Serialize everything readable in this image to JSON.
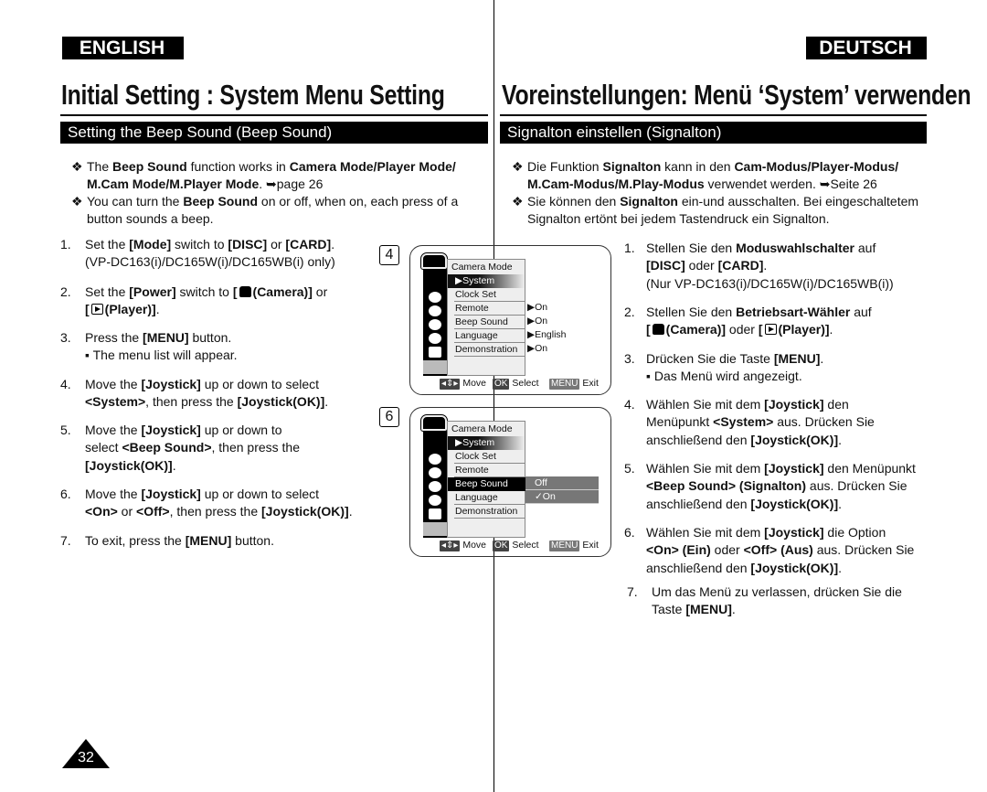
{
  "header": {
    "english": "ENGLISH",
    "deutsch": "DEUTSCH",
    "title_en": "Initial Setting : System Menu Setting",
    "title_de": "Voreinstellungen: Menü ‘System’ verwenden",
    "section_en": "Setting the Beep Sound (Beep Sound)",
    "section_de": "Signalton einstellen (Signalton)"
  },
  "en": {
    "bullets": [
      [
        [
          "The ",
          {
            "b": "Beep Sound"
          },
          " function works in ",
          {
            "b": "Camera Mode/Player Mode/"
          }
        ],
        [
          {
            "b": "M.Cam Mode/M.Player Mode"
          },
          ". ➥page 26"
        ]
      ],
      [
        [
          "You can turn the ",
          {
            "b": "Beep Sound"
          },
          " on or off, when on, each press of a"
        ],
        [
          "button sounds a beep."
        ]
      ]
    ],
    "steps": [
      {
        "n": "1.",
        "lines": [
          [
            "Set the ",
            {
              "b": "[Mode]"
            },
            " switch to ",
            {
              "b": "[DISC]"
            },
            " or ",
            {
              "b": "[CARD]"
            },
            "."
          ],
          [
            "(VP-DC163(i)/DC165W(i)/DC165WB(i) only)"
          ]
        ]
      },
      {
        "n": "2.",
        "lines": [
          [
            "Set the ",
            {
              "b": "[Power]"
            },
            " switch to ",
            {
              "b": "["
            },
            {
              "i": "cam"
            },
            {
              "b": "(Camera)]"
            },
            " or"
          ],
          [
            {
              "b": "["
            },
            {
              "i": "play"
            },
            {
              "b": "(Player)]"
            },
            "."
          ]
        ]
      },
      {
        "n": "3.",
        "lines": [
          [
            "Press the ",
            {
              "b": "[MENU]"
            },
            " button."
          ],
          [
            "▪  The menu list will appear."
          ]
        ]
      },
      {
        "n": "4.",
        "lines": [
          [
            "Move the ",
            {
              "b": "[Joystick]"
            },
            " up or down to select"
          ],
          [
            {
              "b": "<System>"
            },
            ", then press the ",
            {
              "b": "[Joystick(OK)]"
            },
            "."
          ]
        ]
      },
      {
        "n": "5.",
        "lines": [
          [
            "Move the ",
            {
              "b": "[Joystick]"
            },
            " up or down to"
          ],
          [
            "select ",
            {
              "b": "<Beep Sound>"
            },
            ", then press the"
          ],
          [
            {
              "b": "[Joystick(OK)]"
            },
            "."
          ]
        ]
      },
      {
        "n": "6.",
        "lines": [
          [
            "Move the ",
            {
              "b": "[Joystick]"
            },
            " up or down to select"
          ],
          [
            {
              "b": "<On>"
            },
            " or ",
            {
              "b": "<Off>"
            },
            ", then press the ",
            {
              "b": "[Joystick(OK)]"
            },
            "."
          ]
        ]
      },
      {
        "n": "7.",
        "lines": [
          [
            "To exit, press the ",
            {
              "b": "[MENU]"
            },
            " button."
          ]
        ]
      }
    ]
  },
  "de": {
    "bullets": [
      [
        [
          "Die Funktion ",
          {
            "b": "Signalton"
          },
          " kann in den ",
          {
            "b": "Cam-Modus/Player-Modus/"
          }
        ],
        [
          {
            "b": "M.Cam-Modus/M.Play-Modus"
          },
          " verwendet werden. ➥Seite 26"
        ]
      ],
      [
        [
          "Sie können den ",
          {
            "b": "Signalton"
          },
          " ein-und ausschalten. Bei eingeschaltetem"
        ],
        [
          "Signalton ertönt bei jedem Tastendruck ein Signalton."
        ]
      ]
    ],
    "steps": [
      {
        "n": "1.",
        "lines": [
          [
            "Stellen Sie den ",
            {
              "b": "Moduswahlschalter"
            },
            " auf"
          ],
          [
            {
              "b": "[DISC]"
            },
            " oder ",
            {
              "b": "[CARD]"
            },
            "."
          ],
          [
            "(Nur VP-DC163(i)/DC165W(i)/DC165WB(i))"
          ]
        ]
      },
      {
        "n": "2.",
        "lines": [
          [
            "Stellen Sie den ",
            {
              "b": "Betriebsart-Wähler"
            },
            " auf"
          ],
          [
            {
              "b": "["
            },
            {
              "i": "cam"
            },
            {
              "b": "(Camera)]"
            },
            " oder ",
            {
              "b": "["
            },
            {
              "i": "play"
            },
            {
              "b": "(Player)]"
            },
            "."
          ]
        ]
      },
      {
        "n": "3.",
        "lines": [
          [
            "Drücken Sie die Taste ",
            {
              "b": "[MENU]"
            },
            "."
          ],
          [
            "▪  Das Menü wird angezeigt."
          ]
        ]
      },
      {
        "n": "4.",
        "lines": [
          [
            "Wählen Sie mit dem ",
            {
              "b": "[Joystick]"
            },
            " den"
          ],
          [
            "Menüpunkt ",
            {
              "b": "<System>"
            },
            " aus. Drücken Sie"
          ],
          [
            "anschließend den ",
            {
              "b": "[Joystick(OK)]"
            },
            "."
          ]
        ]
      },
      {
        "n": "5.",
        "lines": [
          [
            "Wählen Sie mit dem ",
            {
              "b": "[Joystick]"
            },
            " den Menüpunkt"
          ],
          [
            {
              "b": "<Beep Sound> (Signalton)"
            },
            " aus. Drücken Sie"
          ],
          [
            "anschließend den ",
            {
              "b": "[Joystick(OK)]"
            },
            "."
          ]
        ]
      },
      {
        "n": "6.",
        "lines": [
          [
            "Wählen Sie mit dem ",
            {
              "b": "[Joystick]"
            },
            " die Option"
          ],
          [
            {
              "b": "<On> (Ein)"
            },
            " oder ",
            {
              "b": "<Off> (Aus)"
            },
            " aus. Drücken Sie"
          ],
          [
            "anschließend den ",
            {
              "b": "[Joystick(OK)]"
            },
            "."
          ]
        ]
      },
      {
        "n": "7.",
        "lines": [
          [
            "Um das Menü zu verlassen, drücken Sie die"
          ],
          [
            "Taste ",
            {
              "b": "[MENU]"
            },
            "."
          ]
        ]
      }
    ]
  },
  "screens": [
    {
      "step": "4",
      "mode": "Camera Mode",
      "system": "▶System",
      "items": [
        "Clock Set",
        "Remote",
        "Beep Sound",
        "Language",
        "Demonstration"
      ],
      "values": [
        "",
        "▶On",
        "▶On",
        "▶English",
        "▶On"
      ],
      "selected": -1,
      "submenu": []
    },
    {
      "step": "6",
      "mode": "Camera Mode",
      "system": "▶System",
      "items": [
        "Clock Set",
        "Remote",
        "Beep Sound",
        "Language",
        "Demonstration"
      ],
      "values": [
        "",
        "",
        "",
        "",
        ""
      ],
      "selected": 2,
      "submenu": [
        "Off",
        "✓On"
      ]
    }
  ],
  "screen_footer": {
    "move_key": "◂⇕▸",
    "move": "Move",
    "ok_key": "OK",
    "select": "Select",
    "menu_key": "MENU",
    "exit": "Exit"
  },
  "page_number": "32"
}
